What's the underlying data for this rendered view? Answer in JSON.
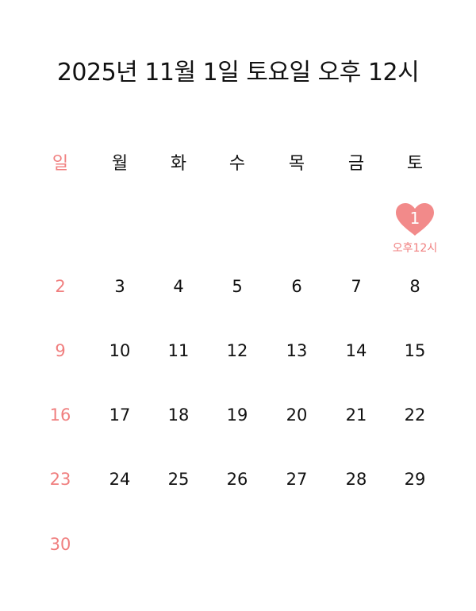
{
  "title": "2025년 11월 1일 토요일 오후 12시",
  "weekdays": [
    "일",
    "월",
    "화",
    "수",
    "목",
    "금",
    "토"
  ],
  "weeks": [
    [
      "",
      "",
      "",
      "",
      "",
      "",
      "1"
    ],
    [
      "2",
      "3",
      "4",
      "5",
      "6",
      "7",
      "8"
    ],
    [
      "9",
      "10",
      "11",
      "12",
      "13",
      "14",
      "15"
    ],
    [
      "16",
      "17",
      "18",
      "19",
      "20",
      "21",
      "22"
    ],
    [
      "23",
      "24",
      "25",
      "26",
      "27",
      "28",
      "29"
    ],
    [
      "30",
      "",
      "",
      "",
      "",
      "",
      ""
    ]
  ],
  "highlight": {
    "day": "1",
    "time_label": "오후12시"
  },
  "colors": {
    "sunday": "#f07f7f",
    "heart": "#f28a8a",
    "text": "#111111"
  }
}
